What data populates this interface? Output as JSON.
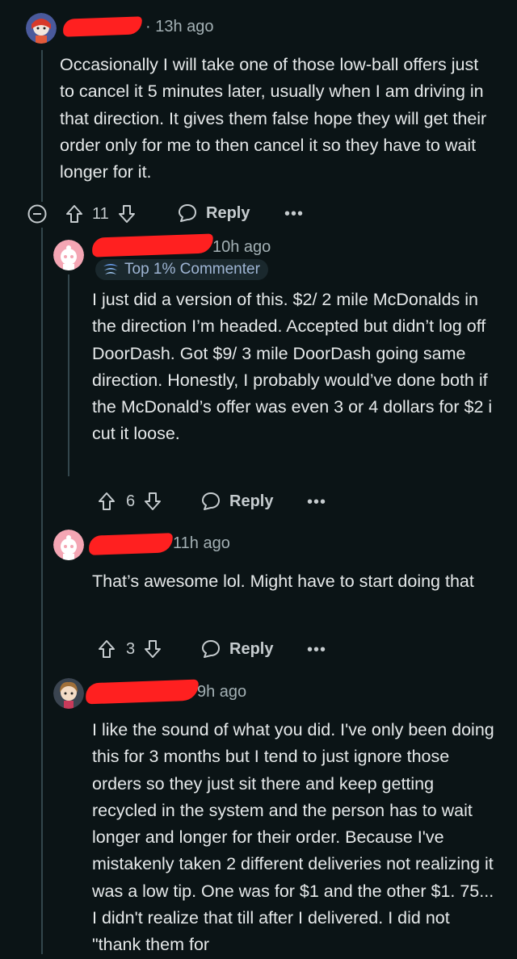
{
  "comments": [
    {
      "time": "13h ago",
      "body": "Occasionally I will take one of those low-ball offers just to cancel it 5 minutes later, usually when I am driving in that direction. It gives them false hope they will get their order only for me to then cancel it so they have to wait longer for it.",
      "votes": "11",
      "reply_label": "Reply",
      "more_label": "•••"
    },
    {
      "time": "10h ago",
      "badge": "Top 1% Commenter",
      "body": "I just did a version of this. $2/ 2 mile McDonalds in the direction I’m headed. Accepted but didn’t log off DoorDash. Got $9/ 3 mile DoorDash going same direction. Honestly, I probably would’ve done both if the McDonald’s offer was even 3 or 4 dollars for $2 i cut it loose.",
      "votes": "6",
      "reply_label": "Reply",
      "more_label": "•••"
    },
    {
      "time": "11h ago",
      "body": "That’s awesome lol. Might have to start doing that",
      "votes": "3",
      "reply_label": "Reply",
      "more_label": "•••"
    },
    {
      "time": "9h ago",
      "body": "I like the sound of what you did. I've only been doing this for 3 months but I tend to just ignore those orders so they just sit there and keep getting recycled in the system and the person has to wait longer and longer for their order. Because I've mistakenly taken 2 different deliveries not realizing it was a low tip. One was for $1 and the other $1. 75... I didn't realize that till after I delivered. I did not \"thank them for"
    }
  ],
  "icons": {
    "collapse": "collapse-minus-icon",
    "upvote": "arrow-up-icon",
    "downvote": "arrow-down-icon",
    "reply": "speech-bubble-icon",
    "more": "more-dots-icon",
    "badge": "top-commenter-badge-icon"
  },
  "colors": {
    "background": "#0b1416",
    "text": "#e6e9ea",
    "muted": "#a3b0b4",
    "redaction": "#ff2020",
    "thread_line": "#33464c"
  }
}
